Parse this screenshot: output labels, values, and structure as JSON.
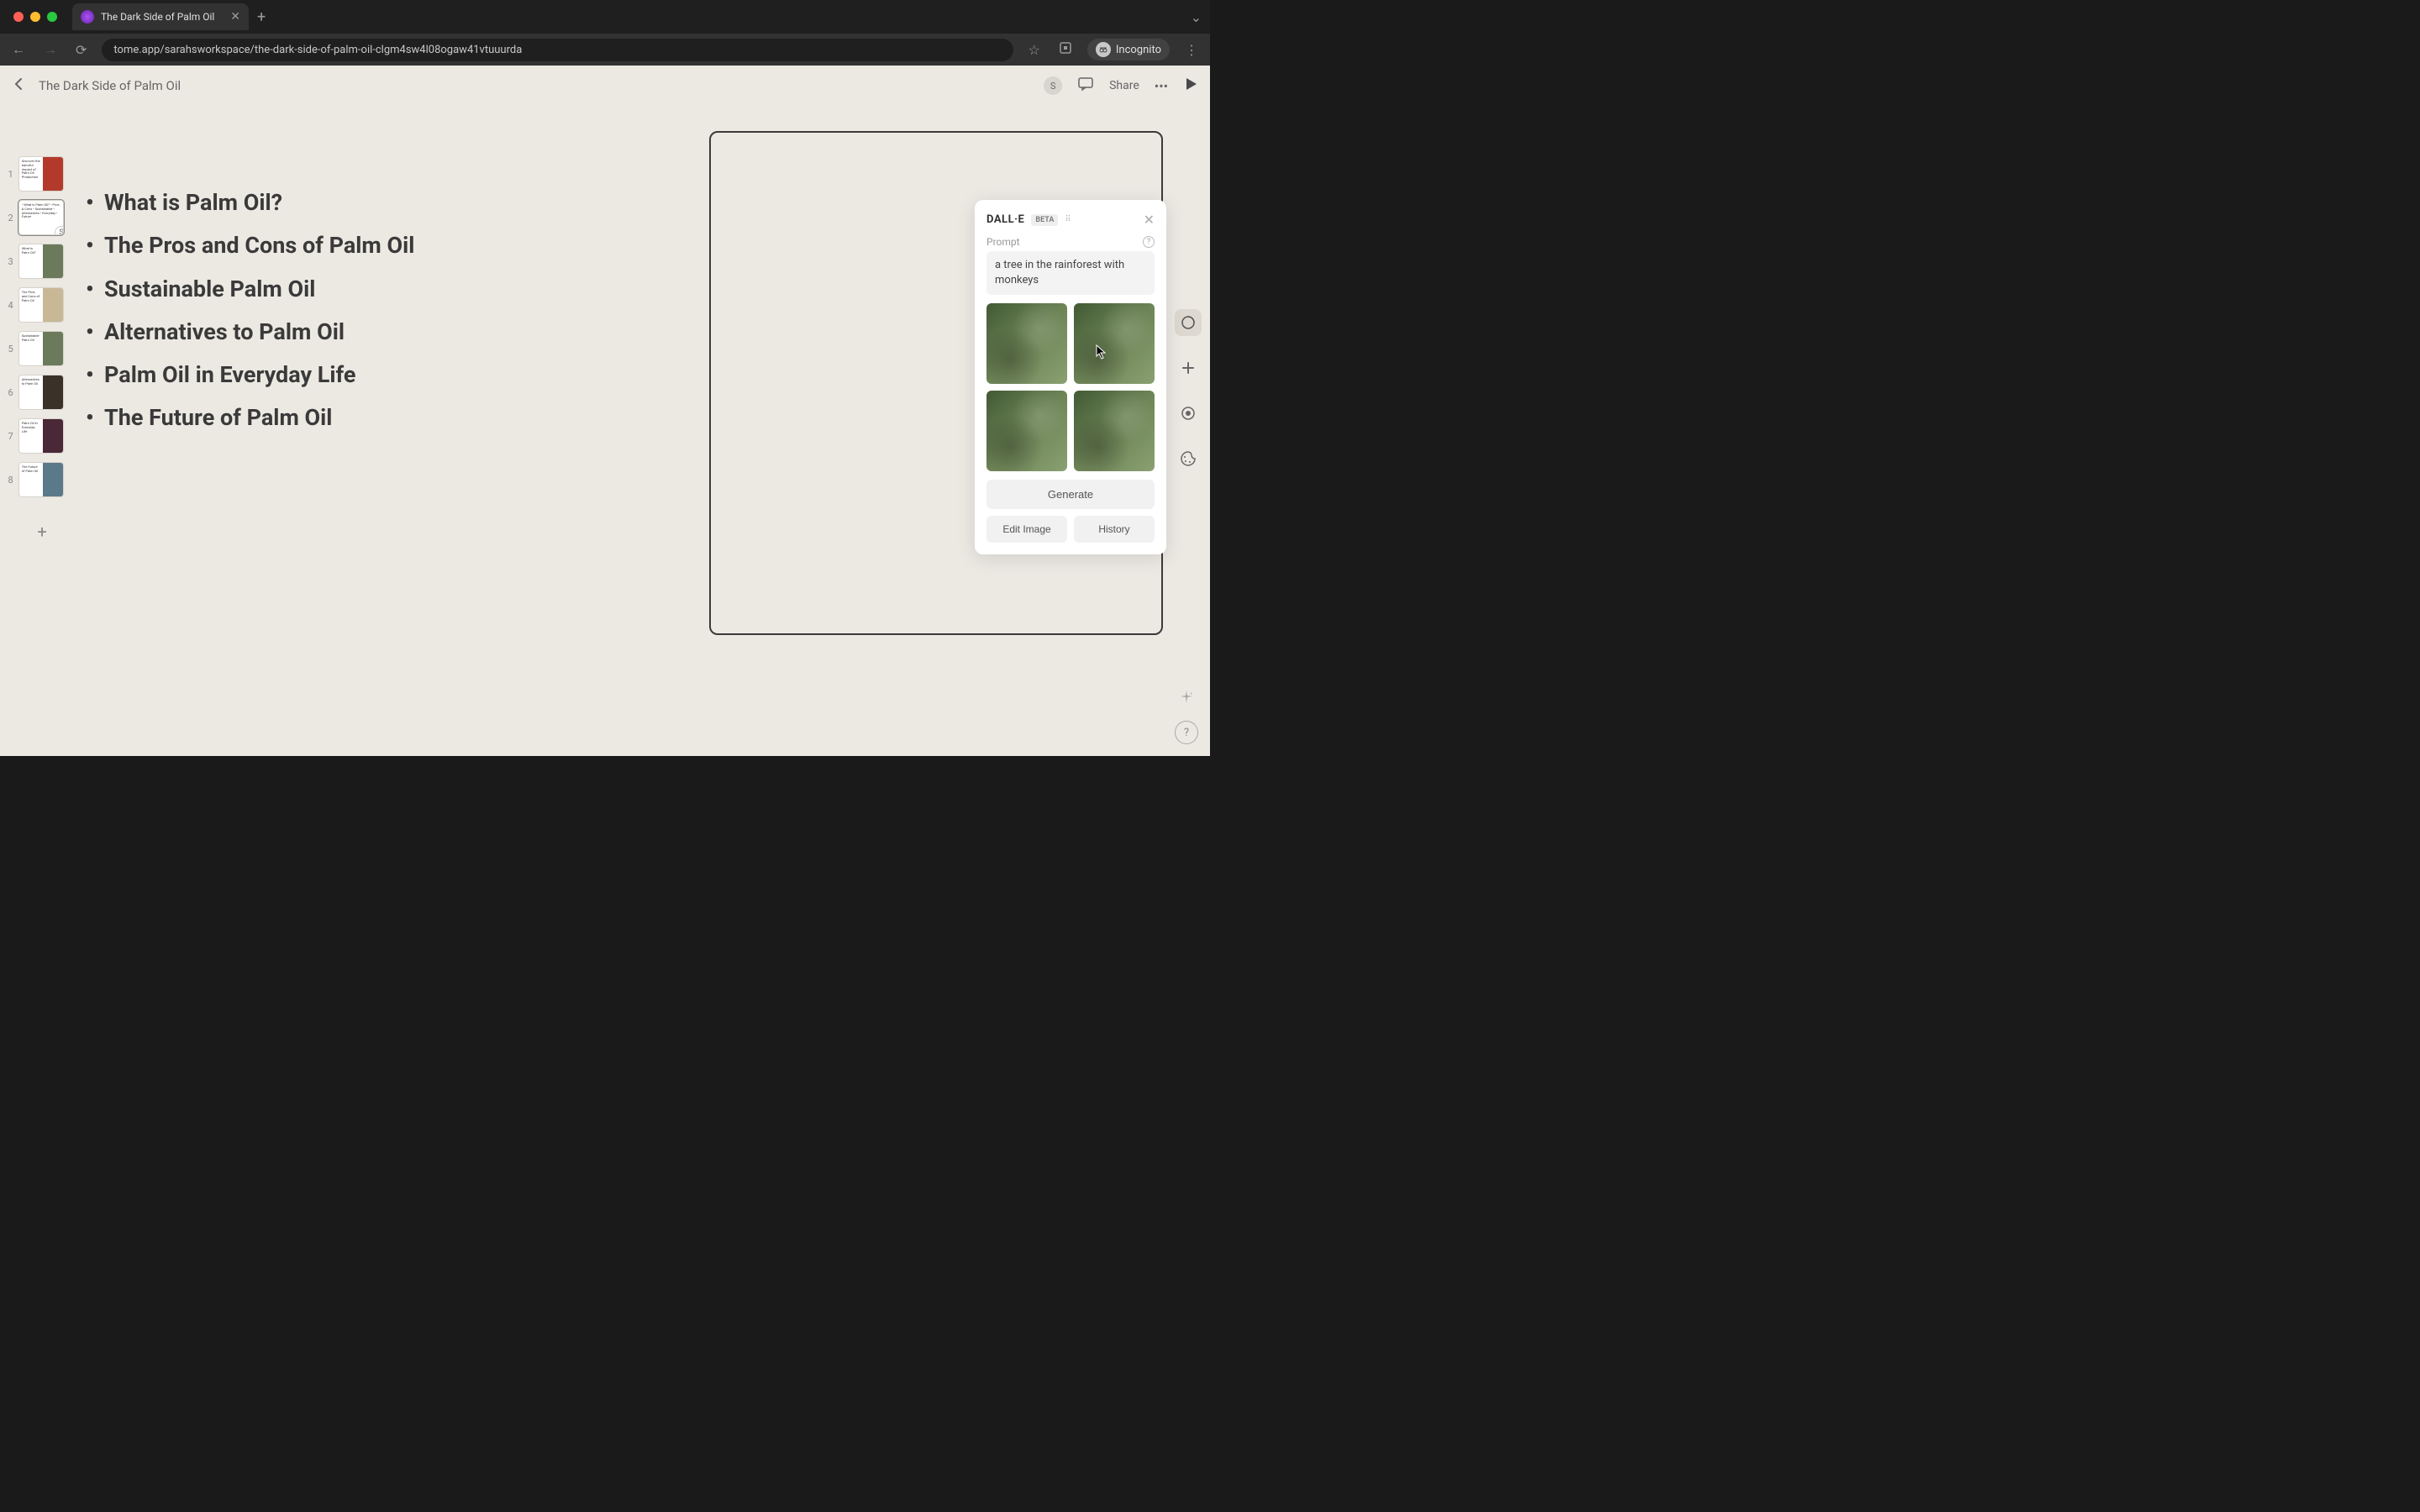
{
  "browser": {
    "tab_title": "The Dark Side of Palm Oil",
    "url": "tome.app/sarahsworkspace/the-dark-side-of-palm-oil-clgm4sw4l08ogaw41vtuuurda",
    "incognito_label": "Incognito"
  },
  "header": {
    "doc_title": "The Dark Side of Palm Oil",
    "share_label": "Share",
    "avatar_initial": "S"
  },
  "thumbs": {
    "active_index": 2,
    "items": [
      {
        "num": "1",
        "text": "Discover the harmful impact of Palm Oil Production"
      },
      {
        "num": "2",
        "text": "• What is Palm Oil? • Pros & Cons • Sustainable • Alternatives • Everyday • Future"
      },
      {
        "num": "3",
        "text": "What is Palm Oil?"
      },
      {
        "num": "4",
        "text": "The Pros and Cons of Palm Oil"
      },
      {
        "num": "5",
        "text": "Sustainable Palm Oil"
      },
      {
        "num": "6",
        "text": "Alternatives to Palm Oil"
      },
      {
        "num": "7",
        "text": "Palm Oil in Everyday Life"
      },
      {
        "num": "8",
        "text": "The Future of Palm Oil"
      }
    ]
  },
  "slide": {
    "bullets": [
      "What is Palm Oil?",
      "The Pros and Cons of Palm Oil",
      "Sustainable Palm Oil",
      "Alternatives to Palm Oil",
      "Palm Oil in Everyday Life",
      "The Future of Palm Oil"
    ]
  },
  "dalle": {
    "title": "DALL·E",
    "beta": "BETA",
    "prompt_label": "Prompt",
    "prompt_value": "a tree in the rainforest with monkeys",
    "generate_label": "Generate",
    "edit_label": "Edit Image",
    "history_label": "History"
  }
}
